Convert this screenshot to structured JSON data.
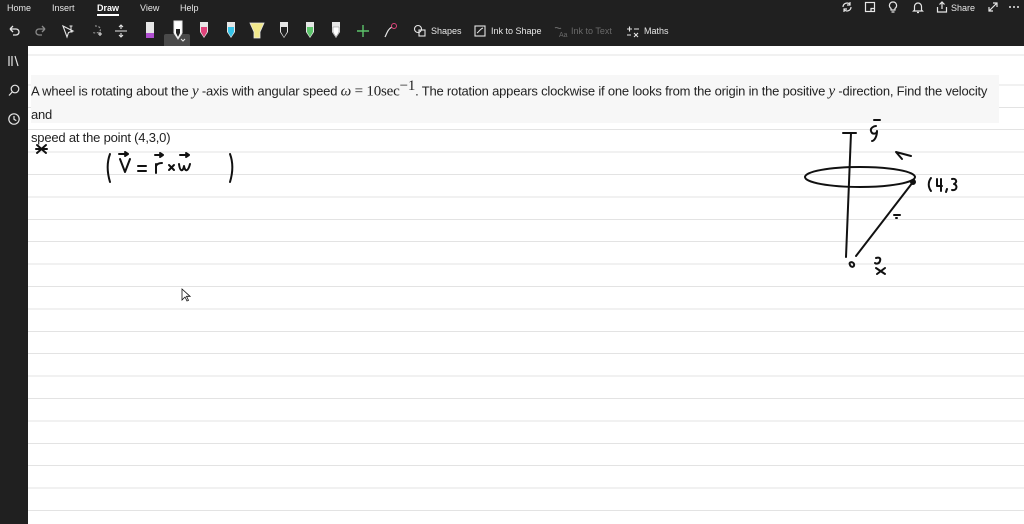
{
  "menu": {
    "tabs": [
      {
        "label": "Home"
      },
      {
        "label": "Insert"
      },
      {
        "label": "Draw",
        "active": true
      },
      {
        "label": "View"
      },
      {
        "label": "Help"
      }
    ],
    "share_label": "Share"
  },
  "toolbar": {
    "shapes_label": "Shapes",
    "ink_to_shape_label": "Ink to Shape",
    "ink_to_text_label": "Ink to Text",
    "maths_label": "Maths",
    "pen_colors": [
      "#222222",
      "#222222",
      "#e0427a",
      "#36c3e8",
      "#f1e88c",
      "#222222",
      "#5cc46a",
      "#ffffff"
    ]
  },
  "question": {
    "part1": "A wheel is rotating about the ",
    "axis_symbol": "y",
    "part2": " -axis with angular speed ",
    "omega_symbol": "ω",
    "equals": " = 10sec",
    "exponent": "−1",
    "part3": ". The rotation appears clockwise if one looks from the origin in the positive ",
    "axis_symbol_2": "y",
    "part4": " -direction, Find the velocity and",
    "line2": "speed at the point (4,3,0)"
  },
  "ink": {
    "formula": "( v = r × ω )",
    "point_label": "(4,3",
    "axis_label": "y",
    "origin_label": "o"
  }
}
